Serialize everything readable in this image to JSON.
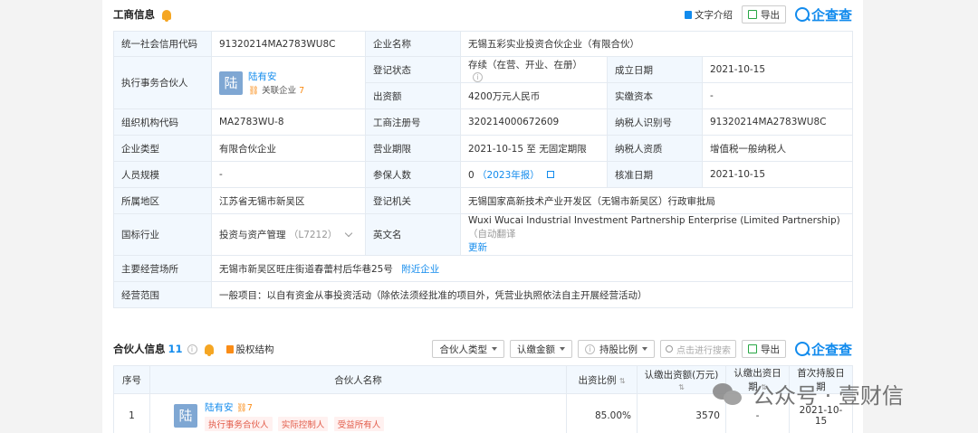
{
  "business": {
    "title": "工商信息",
    "text_intro": "文字介绍",
    "export": "导出",
    "brand": "企查查",
    "rows": {
      "credit_code_label": "统一社会信用代码",
      "credit_code": "91320214MA2783WU8C",
      "company_name_label": "企业名称",
      "company_name": "无锡五彩实业投资合伙企业（有限合伙）",
      "exec_partner_label": "执行事务合伙人",
      "exec_partner_name": "陆有安",
      "exec_partner_avatar": "陆",
      "exec_partner_rel": "关联企业",
      "exec_partner_rel_count": "7",
      "reg_status_label": "登记状态",
      "reg_status": "存续（在营、开业、在册）",
      "established_label": "成立日期",
      "established": "2021-10-15",
      "capital_label": "出资额",
      "capital": "4200万元人民币",
      "paid_capital_label": "实缴资本",
      "paid_capital": "-",
      "org_code_label": "组织机构代码",
      "org_code": "MA2783WU-8",
      "reg_no_label": "工商注册号",
      "reg_no": "320214000672609",
      "taxpayer_id_label": "纳税人识别号",
      "taxpayer_id": "91320214MA2783WU8C",
      "type_label": "企业类型",
      "type": "有限合伙企业",
      "term_label": "营业期限",
      "term": "2021-10-15 至 无固定期限",
      "taxpayer_qual_label": "纳税人资质",
      "taxpayer_qual": "增值税一般纳税人",
      "staff_label": "人员规模",
      "staff": "-",
      "insured_label": "参保人数",
      "insured": "0",
      "insured_year": "（2023年报）",
      "approval_label": "核准日期",
      "approval": "2021-10-15",
      "region_label": "所属地区",
      "region": "江苏省无锡市新吴区",
      "authority_label": "登记机关",
      "authority": "无锡国家高新技术产业开发区（无锡市新吴区）行政审批局",
      "industry_label": "国标行业",
      "industry": "投资与资产管理",
      "industry_code": "（L7212）",
      "english_label": "英文名",
      "english": "Wuxi Wucai Industrial Investment Partnership Enterprise (Limited Partnership)",
      "auto_translate": "（自动翻译",
      "update": "更新",
      "address_label": "主要经营场所",
      "address": "无锡市新吴区旺庄街道春蕾村后华巷25号",
      "nearby": "附近企业",
      "scope_label": "经营范围",
      "scope": "一般项目：以自有资金从事投资活动（除依法须经批准的项目外，凭营业执照依法自主开展经营活动）"
    }
  },
  "partners": {
    "title": "合伙人信息",
    "count": "11",
    "equity_structure": "股权结构",
    "filter_type": "合伙人类型",
    "filter_amount": "认缴金额",
    "filter_ratio": "持股比例",
    "search_placeholder": "点击进行搜索",
    "export": "导出",
    "brand": "企查查",
    "columns": [
      "序号",
      "合伙人名称",
      "出资比例",
      "认缴出资额(万元)",
      "认缴出资日期",
      "首次持股日期"
    ],
    "rows": [
      {
        "index": "1",
        "avatar": "陆",
        "name": "陆有安",
        "rel_count": "7",
        "tags": [
          "执行事务合伙人",
          "实际控制人",
          "受益所有人"
        ],
        "ratio": "85.00%",
        "amount": "3570",
        "date": "-",
        "first_date": "2021-10-15"
      }
    ]
  },
  "watermark": {
    "text": "公众号 · 壹财信"
  }
}
